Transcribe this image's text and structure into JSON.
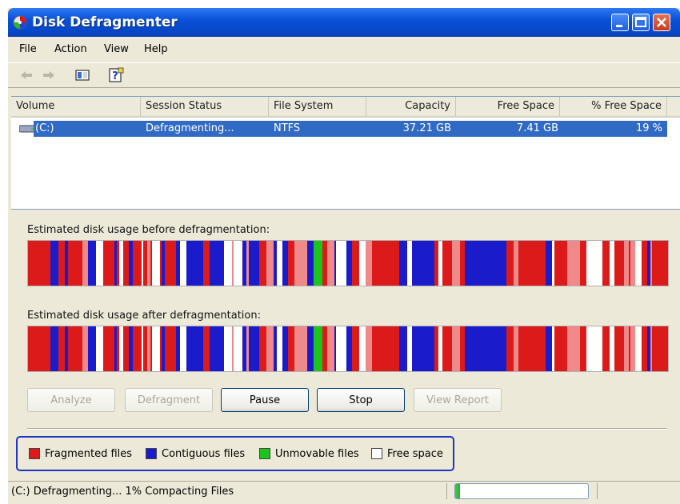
{
  "window": {
    "title": "Disk Defragmenter"
  },
  "menu": [
    "File",
    "Action",
    "View",
    "Help"
  ],
  "toolbar_icons": [
    "back-arrow-icon",
    "forward-arrow-icon",
    "console-tree-icon",
    "help-icon"
  ],
  "volume_table": {
    "headers": [
      "Volume",
      "Session Status",
      "File System",
      "Capacity",
      "Free Space",
      "% Free Space"
    ],
    "rows": [
      {
        "volume": "(C:)",
        "status": "Defragmenting...",
        "fs": "NTFS",
        "capacity": "37.21 GB",
        "free": "7.41 GB",
        "pct": "19 %"
      }
    ]
  },
  "analysis": {
    "before_label": "Estimated disk usage before defragmentation:",
    "after_label": "Estimated disk usage after defragmentation:"
  },
  "buttons": {
    "analyze": "Analyze",
    "defragment": "Defragment",
    "pause": "Pause",
    "stop": "Stop",
    "view_report": "View Report"
  },
  "legend": {
    "fragmented": "Fragmented files",
    "contiguous": "Contiguous files",
    "unmovable": "Unmovable files",
    "free": "Free space"
  },
  "colors": {
    "fragmented": "#dd1a1a",
    "fragmented_light": "#f08a8a",
    "contiguous": "#1a1ccc",
    "unmovable": "#1ec41e",
    "free": "#ffffff",
    "selection": "#316ac5"
  },
  "status": {
    "text": "(C:) Defragmenting... 1%  Compacting Files",
    "progress_fraction": 0.01
  }
}
